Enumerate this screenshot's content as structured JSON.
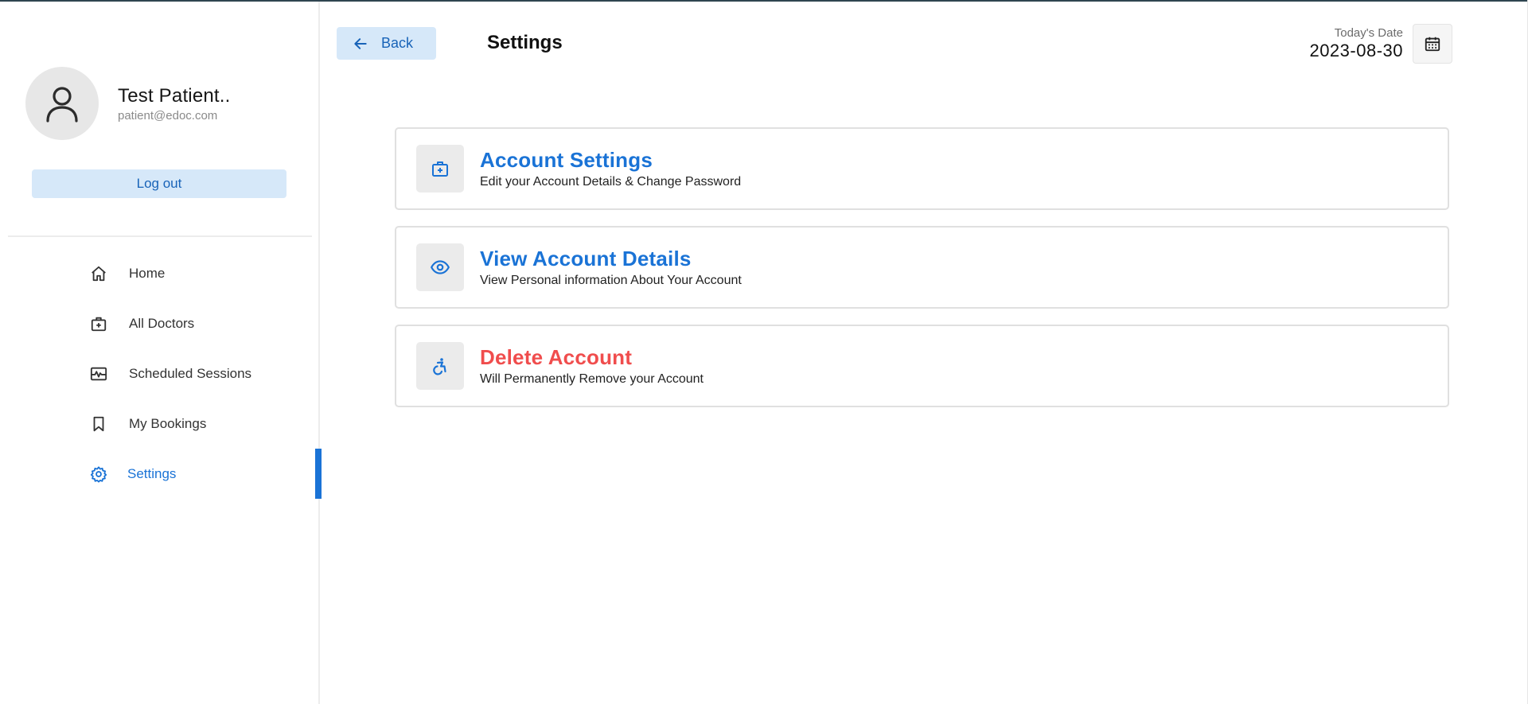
{
  "profile": {
    "name": "Test Patient..",
    "email": "patient@edoc.com",
    "logout_label": "Log out"
  },
  "sidebar": {
    "items": [
      {
        "label": "Home",
        "icon": "home-icon",
        "active": false
      },
      {
        "label": "All Doctors",
        "icon": "medical-briefcase-icon",
        "active": false
      },
      {
        "label": "Scheduled Sessions",
        "icon": "session-monitor-icon",
        "active": false
      },
      {
        "label": "My Bookings",
        "icon": "bookmark-icon",
        "active": false
      },
      {
        "label": "Settings",
        "icon": "gear-icon",
        "active": true
      }
    ]
  },
  "header": {
    "back_label": "Back",
    "title": "Settings",
    "date_label": "Today's Date",
    "date_value": "2023-08-30"
  },
  "cards": [
    {
      "title": "Account Settings",
      "description": "Edit your Account Details & Change Password",
      "icon": "medical-briefcase-icon",
      "tone": "primary"
    },
    {
      "title": "View Account Details",
      "description": "View Personal information About Your Account",
      "icon": "eye-icon",
      "tone": "primary"
    },
    {
      "title": "Delete Account",
      "description": "Will Permanently Remove your Account",
      "icon": "accessibility-icon",
      "tone": "danger"
    }
  ],
  "colors": {
    "accent": "#1a73d6",
    "accent_light": "#d6e8f9",
    "danger": "#f04d4d"
  }
}
